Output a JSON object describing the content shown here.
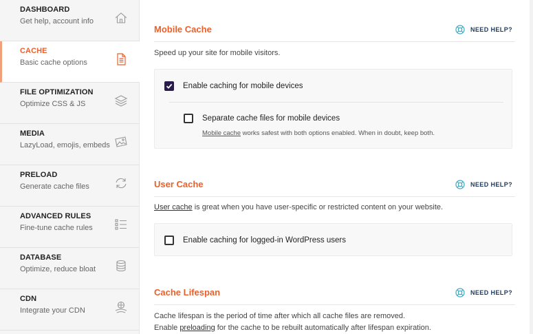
{
  "sidebar": {
    "items": [
      {
        "title": "DASHBOARD",
        "subtitle": "Get help, account info",
        "icon": "home-icon",
        "active": false
      },
      {
        "title": "CACHE",
        "subtitle": "Basic cache options",
        "icon": "file-icon",
        "active": true
      },
      {
        "title": "FILE OPTIMIZATION",
        "subtitle": "Optimize CSS & JS",
        "icon": "layers-icon",
        "active": false
      },
      {
        "title": "MEDIA",
        "subtitle": "LazyLoad, emojis, embeds",
        "icon": "image-icon",
        "active": false
      },
      {
        "title": "PRELOAD",
        "subtitle": "Generate cache files",
        "icon": "refresh-icon",
        "active": false
      },
      {
        "title": "ADVANCED RULES",
        "subtitle": "Fine-tune cache rules",
        "icon": "list-icon",
        "active": false
      },
      {
        "title": "DATABASE",
        "subtitle": "Optimize, reduce bloat",
        "icon": "database-icon",
        "active": false
      },
      {
        "title": "CDN",
        "subtitle": "Integrate your CDN",
        "icon": "cdn-icon",
        "active": false
      }
    ]
  },
  "help_label": "NEED HELP?",
  "mobile": {
    "title": "Mobile Cache",
    "description": "Speed up your site for mobile visitors.",
    "option1": {
      "label": "Enable caching for mobile devices",
      "checked": true
    },
    "option2": {
      "label": "Separate cache files for mobile devices",
      "checked": false
    },
    "note_link": "Mobile cache",
    "note_rest": " works safest with both options enabled. When in doubt, keep both."
  },
  "user": {
    "title": "User Cache",
    "desc_link": "User cache",
    "desc_rest": " is great when you have user-specific or restricted content on your website.",
    "option": {
      "label": "Enable caching for logged-in WordPress users",
      "checked": false
    }
  },
  "lifespan": {
    "title": "Cache Lifespan",
    "line1": "Cache lifespan is the period of time after which all cache files are removed.",
    "line2_pre": "Enable ",
    "line2_link": "preloading",
    "line2_post": " for the cache to be rebuilt automatically after lifespan expiration."
  },
  "colors": {
    "accent": "#e8612c",
    "checkbox": "#2a1c4a",
    "help": "#1f3a5c"
  }
}
